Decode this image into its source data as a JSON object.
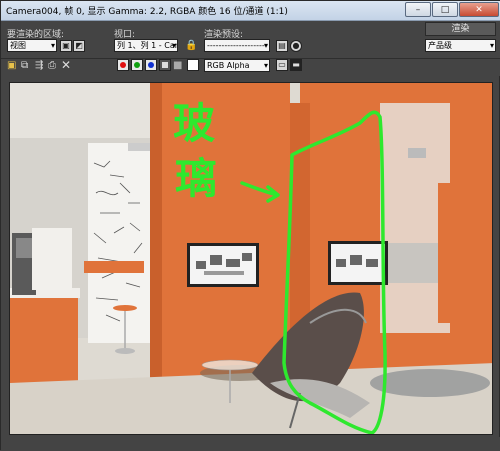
{
  "window": {
    "title": "Camera004, 帧 0, 显示 Gamma: 2.2, RGBA 颜色 16 位/通道 (1:1)",
    "minimize_glyph": "–",
    "maximize_glyph": "□",
    "close_glyph": "✕"
  },
  "toolbar": {
    "area_label": "要渲染的区域:",
    "area_value": "视图",
    "viewport_label": "视口:",
    "viewport_value": "列 1、列 1 - Cam",
    "preset_label": "渲染预设:",
    "preset_value": "---------------------",
    "render_button": "渲染",
    "quality_value": "产品级",
    "channel_value": "RGB Alpha"
  },
  "annotation": {
    "text_line1": "玻",
    "text_line2": "璃",
    "color": "#2ee82e"
  },
  "colors": {
    "accent_orange": "#e0733a",
    "panel_bg": "#444444"
  }
}
